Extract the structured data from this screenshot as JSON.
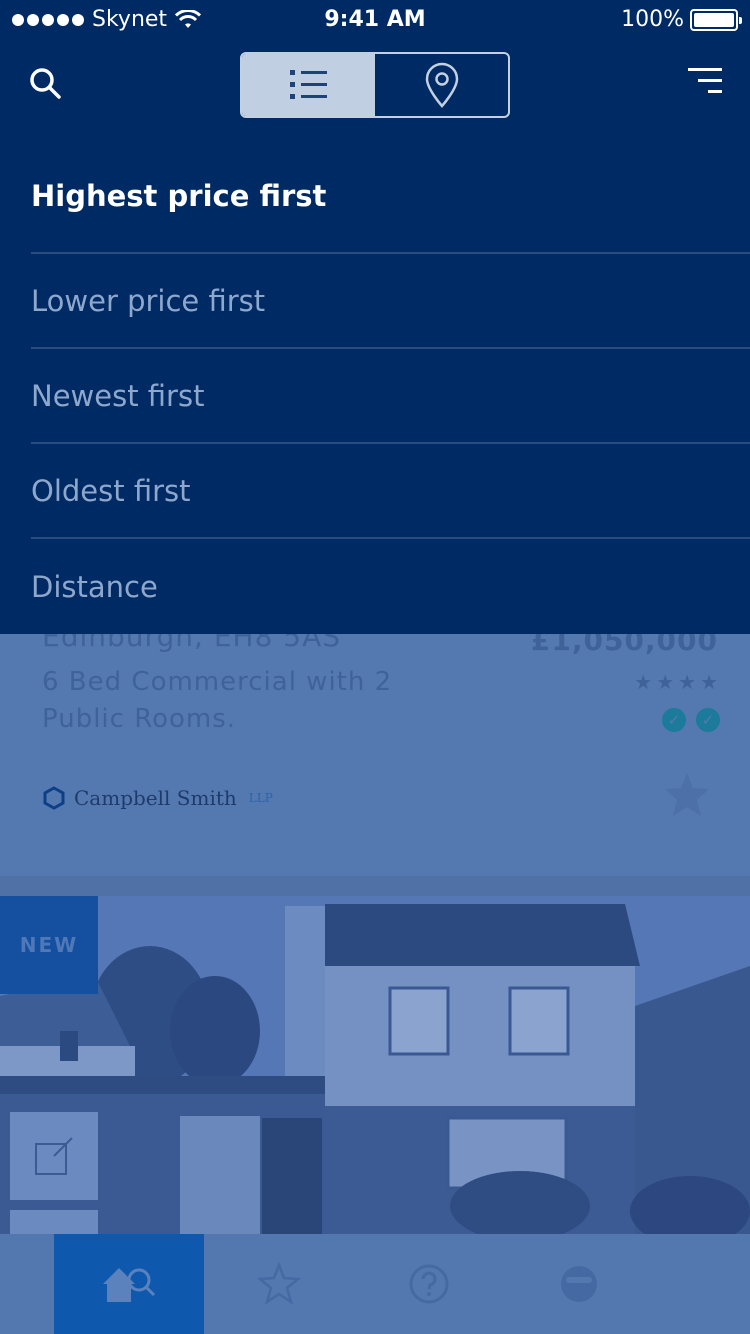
{
  "status_bar": {
    "carrier": "Skynet",
    "time": "9:41 AM",
    "battery": "100%"
  },
  "header": {
    "search_icon": "search-icon",
    "filter_icon": "sort-filter-icon",
    "view_toggle": {
      "list_icon": "list-view-icon",
      "map_icon": "map-pin-icon",
      "active": "list"
    }
  },
  "sort_menu": {
    "options": [
      "Highest price first",
      "Lower price first",
      "Newest first",
      "Oldest first",
      "Distance"
    ],
    "selected": "Highest price first"
  },
  "listing": {
    "address": "Edinburgh, EH8 5AS",
    "price": "£1,050,000",
    "description": "6 Bed Commercial with 2 Public Rooms.",
    "rating": 4,
    "agent_name": "Campbell Smith",
    "agent_suffix": "LLP"
  },
  "photo_listing": {
    "badge": "NEW"
  },
  "tab_bar": {
    "items": [
      "home-search-icon",
      "star-icon",
      "help-icon",
      "profile-icon"
    ],
    "active": "home-search-icon"
  },
  "colors": {
    "nav_bg": "#002a63",
    "menu_divider": "#2a4c7f",
    "selected_text": "#ffffff",
    "unselected_text": "#8ea7cc",
    "active_tab": "#0e58ad"
  }
}
